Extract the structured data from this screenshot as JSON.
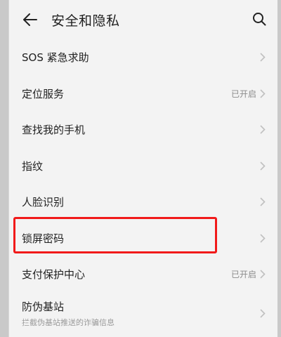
{
  "header": {
    "title": "安全和隐私",
    "back_icon": "arrow-left-icon",
    "search_icon": "search-icon"
  },
  "menu": {
    "items": [
      {
        "label": "SOS 紧急求助",
        "status": ""
      },
      {
        "label": "定位服务",
        "status": "已开启"
      },
      {
        "label": "查找我的手机",
        "status": ""
      },
      {
        "label": "指纹",
        "status": ""
      },
      {
        "label": "人脸识别",
        "status": ""
      },
      {
        "label": "锁屏密码",
        "status": "",
        "highlighted": true
      },
      {
        "label": "支付保护中心",
        "status": "已开启"
      },
      {
        "label": "防伪基站",
        "sublabel": "拦截伪基站推送的诈骗信息",
        "status": ""
      }
    ]
  },
  "colors": {
    "highlight_border": "#f11a1a",
    "background": "#f3f3f3",
    "secondary_text": "#8c8c8c"
  }
}
